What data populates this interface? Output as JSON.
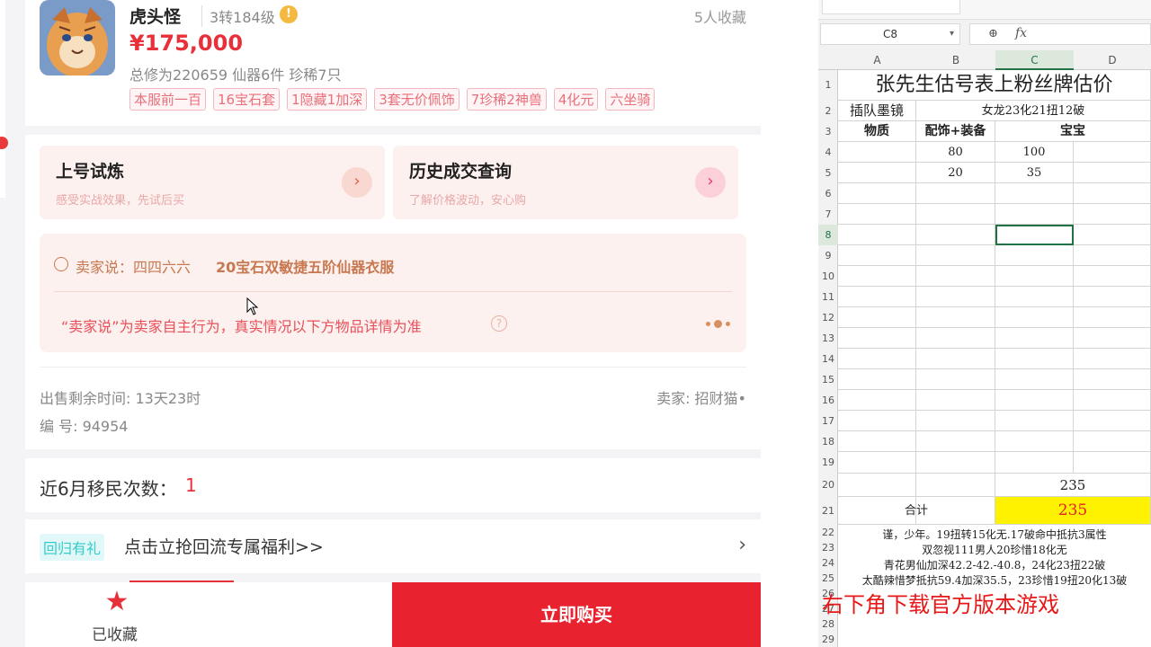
{
  "product": {
    "name": "虎头怪",
    "level": "3转184级",
    "favorites": "5人收藏",
    "price": "¥175,000",
    "stats": "总修为220659  仙器6件  珍稀7只",
    "tags": [
      "本服前一百",
      "16宝石套",
      "1隐藏1加深",
      "3套无价佩饰",
      "7珍稀2神兽",
      "4化元",
      "六坐骑"
    ]
  },
  "tiles": [
    {
      "title": "上号试炼",
      "subtitle": "感受实战效果，先试后买"
    },
    {
      "title": "历史成交查询",
      "subtitle": "了解价格波动，安心购"
    }
  ],
  "seller_says": {
    "label": "卖家说：四四六六",
    "text": "20宝石双敏捷五阶仙器衣服",
    "note": "“卖家说”为卖家自主行为，真实情况以下方物品详情为准"
  },
  "sale_info": {
    "time_left": "出售剩余时间: 13天23时",
    "seller": "卖家: 招财猫•",
    "serial": "编 号: 94954"
  },
  "migration": {
    "label": "近6月移民次数：",
    "value": "1"
  },
  "return_promo": {
    "tag": "回归有礼",
    "text": "点击立抢回流专属福利>>"
  },
  "bottom": {
    "fav_label": "已收藏",
    "buy_label": "立即购买"
  },
  "spreadsheet": {
    "name_box": "C8",
    "fx": "fx",
    "columns": [
      "A",
      "B",
      "C",
      "D"
    ],
    "rows": [
      "1",
      "2",
      "3",
      "4",
      "5",
      "6",
      "7",
      "8",
      "9",
      "10",
      "11",
      "12",
      "13",
      "14",
      "15",
      "16",
      "17",
      "18",
      "19",
      "20",
      "21",
      "22",
      "23",
      "24",
      "25",
      "26",
      "27",
      "28",
      "29"
    ],
    "title": "张先生估号表上粉丝牌估价",
    "r2_label": "插队墨镜",
    "r2_value": "女龙23化21扭12破",
    "h_wuzhi": "物质",
    "h_peishi": "配饰+装备",
    "h_baobao": "宝宝",
    "b4": "80",
    "c4": "100",
    "b5": "20",
    "c5": "35",
    "c20": "235",
    "r21_label": "合计",
    "r21_value": "235",
    "notes": [
      "谨，少年。19扭转15化无.17破命中抵抗3属性",
      "双忽视111男人20珍惜18化无",
      "青花男仙加深42.2-42.-40.8，24化23扭22破",
      "太酷辣惜梦抵抗59.4加深35.5，23珍惜19扭20化13破"
    ],
    "overlay": "右下角下载官方版本游戏"
  }
}
